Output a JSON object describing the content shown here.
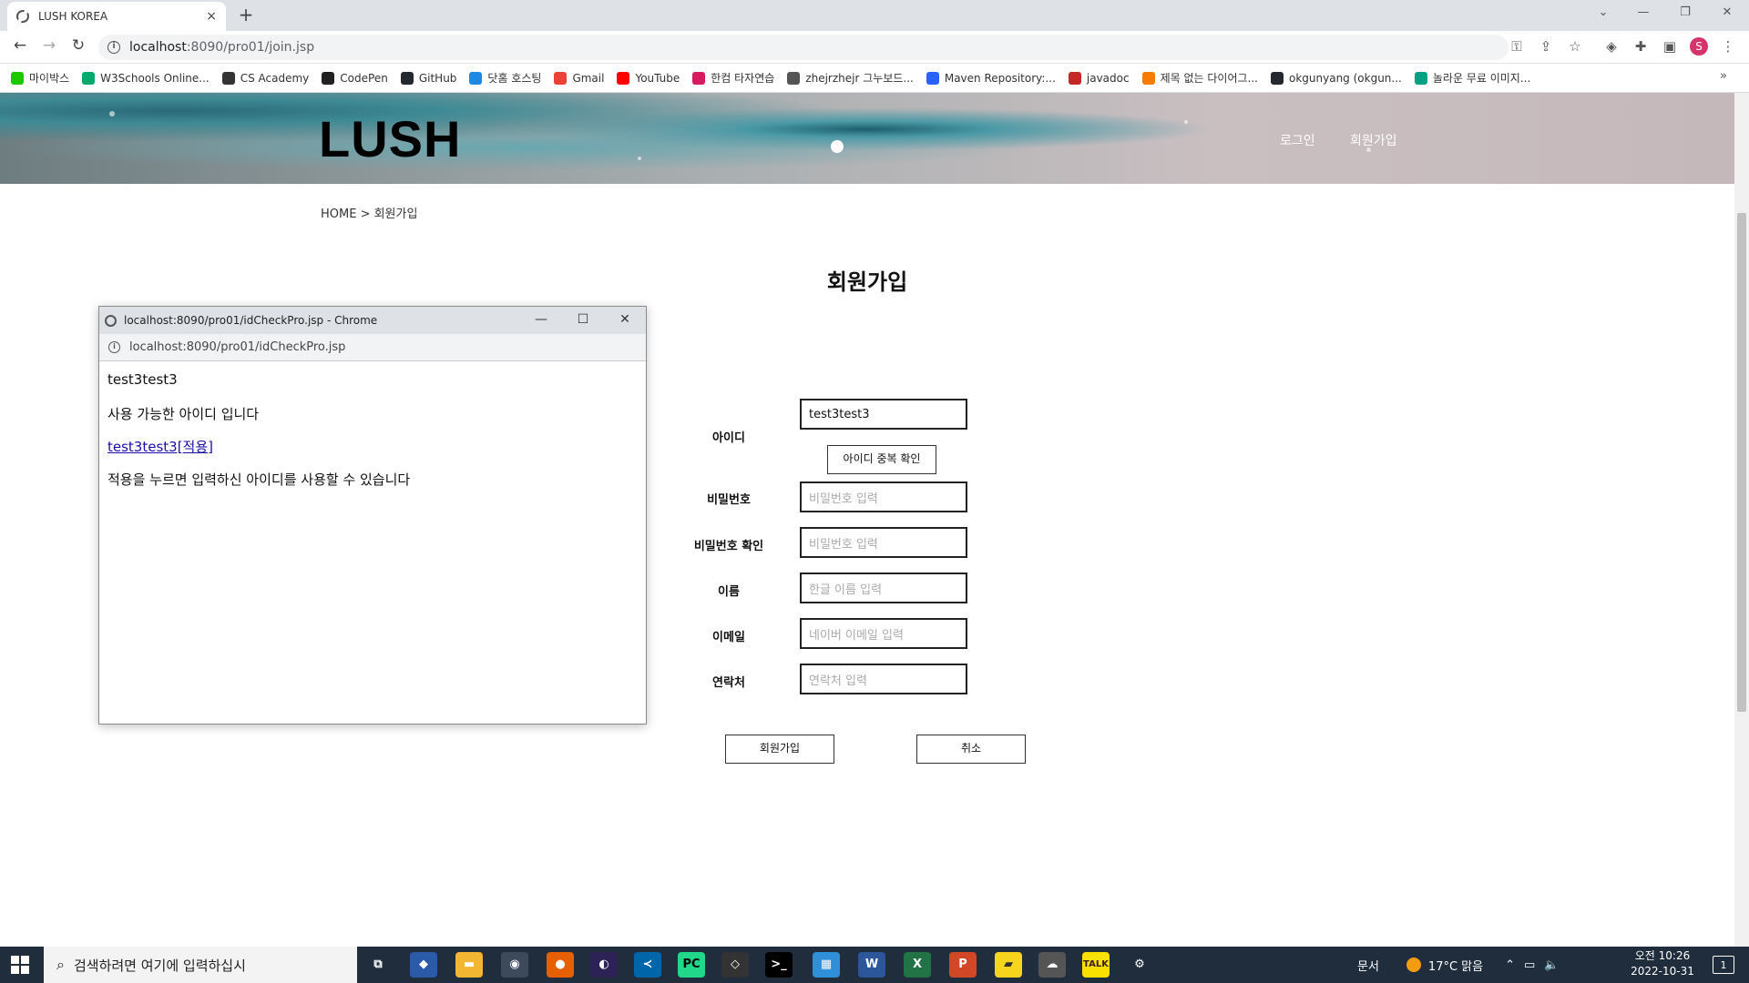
{
  "browser": {
    "tab_title": "LUSH KOREA",
    "tab_close": "×",
    "new_tab": "+",
    "url_host": "localhost",
    "url_path": ":8090/pro01/join.jsp",
    "window_minimize": "—",
    "window_restore": "❐",
    "window_close": "✕",
    "profile_initial": "S"
  },
  "bookmarks": [
    {
      "label": "마이박스",
      "color": "#1ec800"
    },
    {
      "label": "W3Schools Online...",
      "color": "#04aa6d"
    },
    {
      "label": "CS Academy",
      "color": "#333333"
    },
    {
      "label": "CodePen",
      "color": "#222222"
    },
    {
      "label": "GitHub",
      "color": "#24292f"
    },
    {
      "label": "닷홈 호스팅",
      "color": "#1e88e5"
    },
    {
      "label": "Gmail",
      "color": "#ea4335"
    },
    {
      "label": "YouTube",
      "color": "#ff0000"
    },
    {
      "label": "한컴 타자연습",
      "color": "#d81b60"
    },
    {
      "label": "zhejrzhejr 그누보드...",
      "color": "#555555"
    },
    {
      "label": "Maven Repository:...",
      "color": "#2962ff"
    },
    {
      "label": "javadoc",
      "color": "#c62828"
    },
    {
      "label": "제목 없는 다이어그...",
      "color": "#f57c00"
    },
    {
      "label": "okgunyang (okgun...",
      "color": "#24292f"
    },
    {
      "label": "놀라운 무료 이미지...",
      "color": "#05a081"
    }
  ],
  "bookmarks_more": "»",
  "site": {
    "logo": "LUSH",
    "nav": {
      "login": "로그인",
      "join": "회원가입"
    },
    "breadcrumb": "HOME > 회원가입",
    "page_title": "회원가입"
  },
  "form": {
    "id_label": "아이디",
    "id_value": "test3test3",
    "dup_check_button": "아이디 중복 확인",
    "pw_label": "비밀번호",
    "pw_placeholder": "비밀번호 입력",
    "pw2_label": "비밀번호 확인",
    "pw2_placeholder": "비밀번호 입력",
    "name_label": "이름",
    "name_placeholder": "한글 이름 입력",
    "email_label": "이메일",
    "email_placeholder": "네이버 이메일 입력",
    "tel_label": "연락처",
    "tel_placeholder": "연락처 입력",
    "submit_button": "회원가입",
    "cancel_button": "취소"
  },
  "popup": {
    "title": "localhost:8090/pro01/idCheckPro.jsp - Chrome",
    "url": "localhost:8090/pro01/idCheckPro.jsp",
    "checked_id": "test3test3",
    "message": "사용 가능한 아이디 입니다",
    "apply_link": "test3test3[적용]",
    "hint": "적용을 누르면 입력하신 아이디를 사용할 수 있습니다"
  },
  "taskbar": {
    "search_placeholder": "검색하려면 여기에 입력하십시",
    "tray_docs": "문서",
    "weather": "17°C 맑음",
    "time": "오전 10:26",
    "date": "2022-10-31",
    "notification_count": "1"
  }
}
